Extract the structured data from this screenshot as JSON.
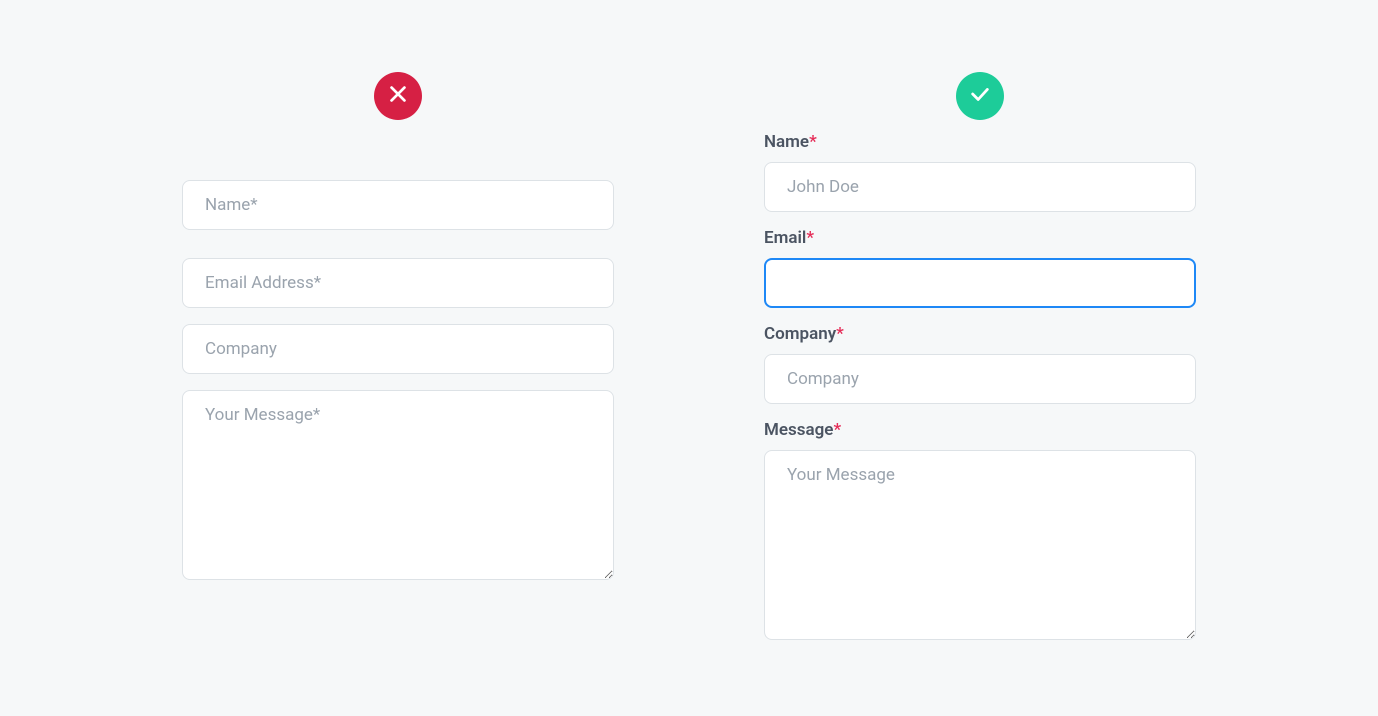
{
  "left": {
    "fields": {
      "name": {
        "placeholder": "Name*"
      },
      "email": {
        "placeholder": "Email Address*"
      },
      "company": {
        "placeholder": "Company"
      },
      "message": {
        "placeholder": "Your Message*"
      }
    }
  },
  "right": {
    "fields": {
      "name": {
        "label": "Name",
        "required": "*",
        "placeholder": "John Doe"
      },
      "email": {
        "label": "Email",
        "required": "*",
        "value": ""
      },
      "company": {
        "label": "Company",
        "required": "*",
        "placeholder": "Company"
      },
      "message": {
        "label": "Message",
        "required": "*",
        "placeholder": "Your Message"
      }
    }
  }
}
